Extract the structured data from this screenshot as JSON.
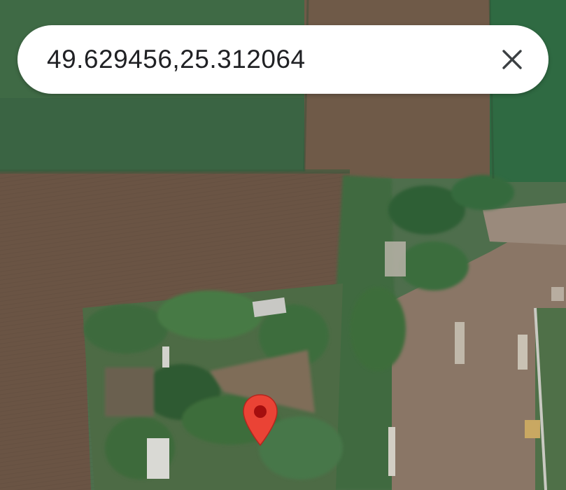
{
  "search": {
    "query": "49.629456,25.312064",
    "clear_icon": "close-icon"
  },
  "marker": {
    "icon": "map-pin-icon",
    "color": "#ea4335"
  },
  "map": {
    "view": "satellite"
  }
}
